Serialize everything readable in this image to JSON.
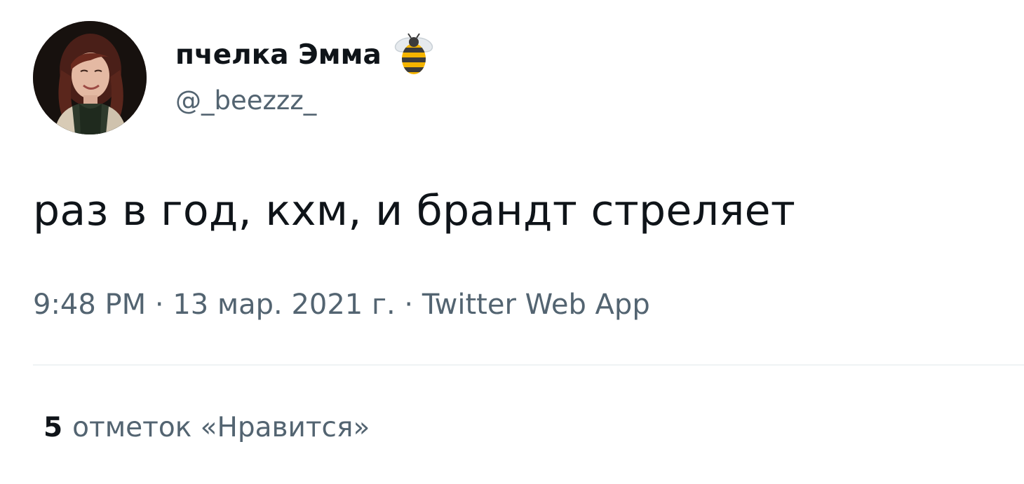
{
  "author": {
    "name": "пчелка Эмма",
    "handle": "@_beezzz_",
    "badge_icon": "bee-icon"
  },
  "tweet": {
    "text": "раз в год, кхм, и брандт стреляет",
    "time": "9:48 PM",
    "separator": " · ",
    "date": "13 мар. 2021 г.",
    "source": "Twitter Web App"
  },
  "stats": {
    "likes_count": "5",
    "likes_label": "отметок «Нравится»"
  },
  "colors": {
    "primary_text": "#0f1419",
    "secondary_text": "#536471",
    "divider": "#eff3f4",
    "bee_yellow": "#f4b400",
    "bee_dark": "#3b3b3b"
  }
}
